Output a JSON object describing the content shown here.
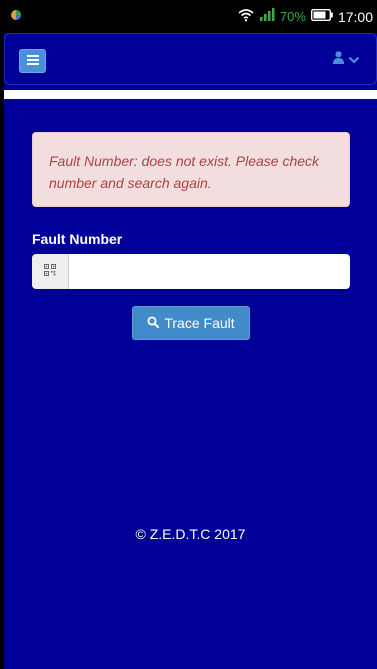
{
  "status_bar": {
    "battery_percent": "70%",
    "time": "17:00"
  },
  "navbar": {
    "menu_icon": "hamburger-icon",
    "user_icon": "user-icon",
    "dropdown_icon": "chevron-down-icon"
  },
  "alert": {
    "message": "Fault Number: does not exist. Please check number and search again."
  },
  "form": {
    "label": "Fault Number",
    "input_value": "",
    "input_icon": "qr-code-icon",
    "button_label": "Trace Fault",
    "button_icon": "search-icon"
  },
  "footer": {
    "text": "© Z.E.D.T.C  2017"
  },
  "colors": {
    "background": "#000099",
    "button": "#428bca",
    "alert_bg": "#f2dede",
    "alert_text": "#a94442",
    "battery": "#3aaa4a"
  }
}
